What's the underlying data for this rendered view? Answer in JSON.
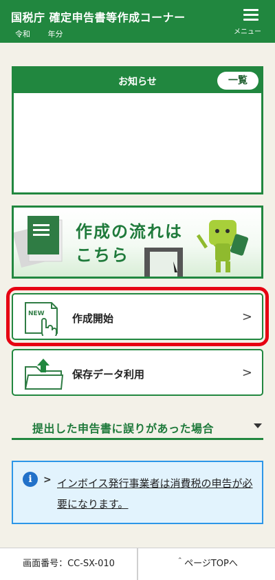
{
  "header": {
    "title": "国税庁 確定申告書等作成コーナー",
    "era": "令和",
    "year_unit": "年分",
    "menu_label": "メニュー"
  },
  "notice": {
    "title": "お知らせ",
    "list_button": "一覧"
  },
  "flow_banner": {
    "line1": "作成の流れは",
    "line2": "こちら"
  },
  "actions": {
    "start_label": "作成開始",
    "saved_label": "保存データ利用",
    "new_badge": "NEW"
  },
  "accordion": {
    "label": "提出した申告書に誤りがあった場合"
  },
  "info": {
    "icon": "i",
    "arrow": ">",
    "link_text": "インボイス発行事業者は消費税の申告が必要になります。"
  },
  "footer": {
    "screen_number": "画面番号：CC-SX-010",
    "top_link": "＾ページTOPへ"
  },
  "colors": {
    "brand_green": "#21873f",
    "highlight_red": "#e60012",
    "info_blue": "#2c96e8",
    "background": "#f3f1e8"
  }
}
